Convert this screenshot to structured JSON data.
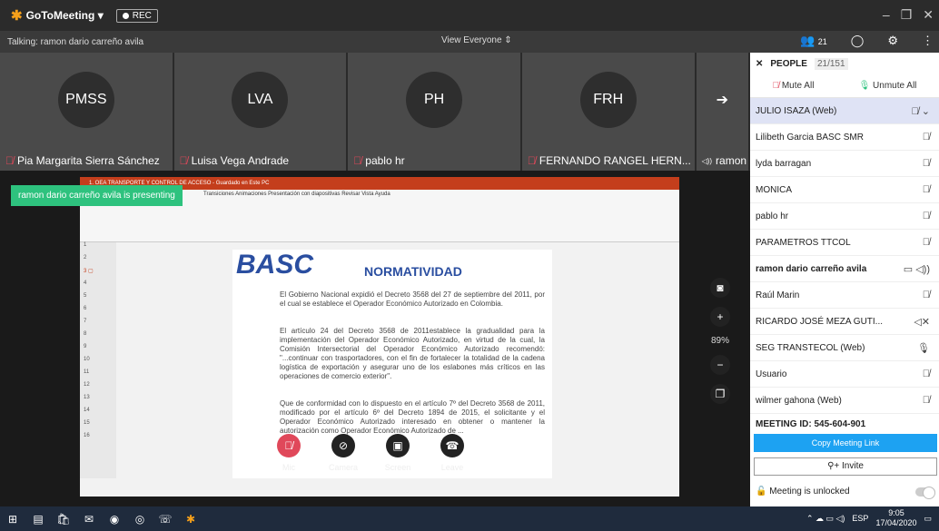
{
  "app": {
    "name": "GoToMeeting",
    "rec": "REC"
  },
  "talking": "Talking: ramon dario carreño avila",
  "view": "View Everyone",
  "attendee_count": "21",
  "tiles": [
    {
      "initials": "PMSS",
      "name": "Pia Margarita Sierra Sánchez"
    },
    {
      "initials": "LVA",
      "name": "Luisa Vega Andrade"
    },
    {
      "initials": "PH",
      "name": "pablo hr"
    },
    {
      "initials": "FRH",
      "name": "FERNANDO RANGEL HERN..."
    },
    {
      "initials": "",
      "name": "ramon"
    }
  ],
  "presenting": "ramon dario carreño avila is presenting",
  "ppt": {
    "title": "1. OEA TRANSPORTE Y CONTROL DE ACCESO - Guardado en Este PC",
    "tabs": "Transiciones   Animaciones   Presentación con diapositivas   Revisar   Vista   Ayuda",
    "slide_title": "NORMATIVIDAD",
    "logo": "BASC",
    "p1": "El Gobierno Nacional expidió el Decreto 3568 del 27 de septiembre del 2011, por el cual se establece el Operador Económico Autorizado en Colombia.",
    "p2": "El artículo 24 del Decreto 3568 de 2011establece la gradualidad para la implementación del Operador Económico Autorizado, en virtud de la cual, la Comisión Intersectorial del Operador Económico Autorizado recomendó: \"...continuar con trasportadores, con el fin de fortalecer la totalidad de la cadena logística de exportación y asegurar uno de los eslabones más críticos en las operaciones de comercio exterior\".",
    "p3": "Que de conformidad con lo dispuesto en el artículo 7º del Decreto 3568 de 2011, modificado por el artículo 6º del Decreto 1894 de 2015, el solicitante y el Operador Económico Autorizado interesado en obtener o mantener la autorización como Operador Económico Autorizado de ..."
  },
  "controls": {
    "mic": "Mic",
    "camera": "Camera",
    "screen": "Screen",
    "leave": "Leave"
  },
  "zoom": "89%",
  "people": {
    "label": "PEOPLE",
    "count": "21/151",
    "mute_all": "Mute All",
    "unmute_all": "Unmute All",
    "list": [
      "JULIO ISAZA (Web)",
      "Lilibeth Garcia BASC SMR",
      "lyda barragan",
      "MONICA",
      "pablo hr",
      "PARAMETROS TTCOL",
      "ramon dario carreño avila",
      "Raúl Marin",
      "RICARDO JOSÉ MEZA GUTI...",
      "SEG TRANSTECOL (Web)",
      "Usuario",
      "wilmer gahona (Web)"
    ],
    "meeting_id": "MEETING ID: 545-604-901",
    "copy_link": "Copy Meeting Link",
    "invite": "Invite",
    "lock": "Meeting is unlocked"
  },
  "taskbar": {
    "lang": "ESP",
    "time": "9:05",
    "date": "17/04/2020"
  }
}
